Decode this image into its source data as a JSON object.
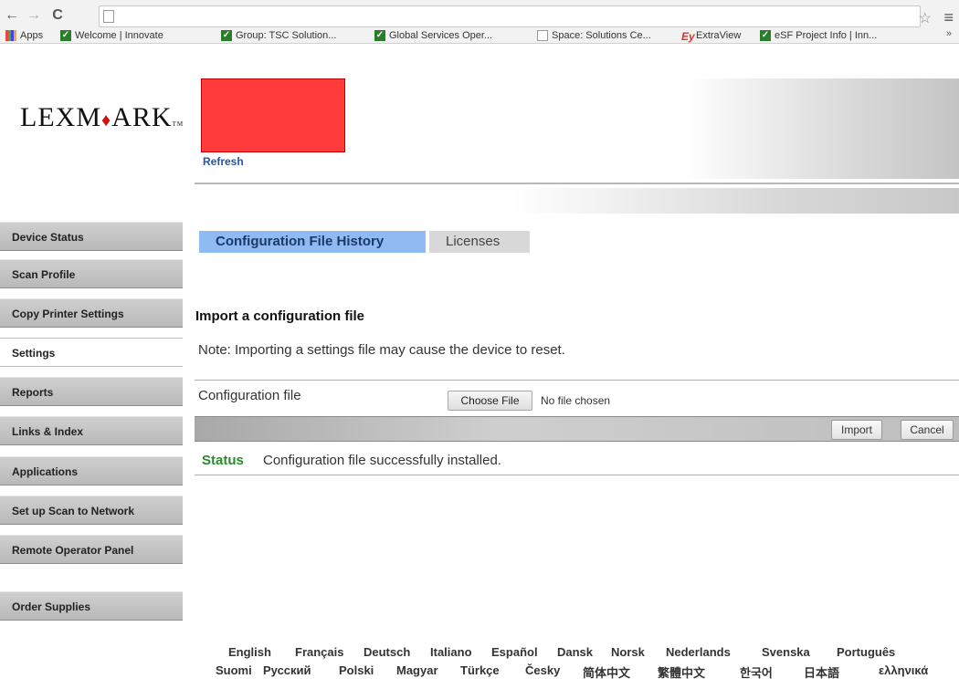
{
  "browser": {
    "nav": {
      "back": "←",
      "forward": "→",
      "reload": "C"
    },
    "bookmarks": [
      {
        "label": "Apps",
        "icon": "apps-grid-icon"
      },
      {
        "label": "Welcome | Innovate",
        "icon": "check-icon"
      },
      {
        "label": "Group: TSC Solution...",
        "icon": "check-icon"
      },
      {
        "label": "Global Services Oper...",
        "icon": "check-icon"
      },
      {
        "label": "Space: Solutions Ce...",
        "icon": "doc-icon"
      },
      {
        "label": "ExtraView",
        "icon": "extraview-icon"
      },
      {
        "label": "eSF Project Info | Inn...",
        "icon": "check-icon"
      }
    ],
    "more": "»"
  },
  "header": {
    "logo_text_a": "LEXM",
    "logo_text_b": "ARK",
    "logo_tm": "TM",
    "alert_lines": [
      "",
      "",
      "",
      ""
    ],
    "refresh_label": "Refresh"
  },
  "sidebar": {
    "items": [
      {
        "label": "Device Status"
      },
      {
        "label": "Scan Profile"
      },
      {
        "label": "Copy Printer Settings"
      },
      {
        "label": "Settings",
        "active": true
      },
      {
        "label": "Reports"
      },
      {
        "label": "Links & Index"
      },
      {
        "label": "Applications"
      },
      {
        "label": "Set up Scan to Network"
      },
      {
        "label": "Remote Operator Panel"
      },
      {
        "label": "Order Supplies"
      }
    ]
  },
  "tabs": [
    {
      "label": "Configuration File History",
      "active": true
    },
    {
      "label": "Licenses",
      "active": false
    }
  ],
  "main": {
    "section_title": "Import a configuration file",
    "note": "Note: Importing a settings file may cause the device to reset.",
    "config_label": "Configuration file",
    "choose_file_label": "Choose File",
    "no_file_text": "No file chosen",
    "import_label": "Import",
    "cancel_label": "Cancel",
    "status_label": "Status",
    "status_text": "Configuration file successfully installed."
  },
  "languages": {
    "row1": [
      "English",
      "Français",
      "Deutsch",
      "Italiano",
      "Español",
      "Dansk",
      "Norsk",
      "Nederlands",
      "Svenska",
      "Português"
    ],
    "row2": [
      "Suomi",
      "Русский",
      "Polski",
      "Magyar",
      "Türkçe",
      "Česky",
      "简体中文",
      "繁體中文",
      "한국어",
      "日本語",
      "ελληνικά"
    ]
  },
  "colors": {
    "tab_active": "#8fbaf2",
    "alert_bg": "#ff3b3b",
    "status_green": "#2a8a2a",
    "link_blue": "#2255aa"
  }
}
